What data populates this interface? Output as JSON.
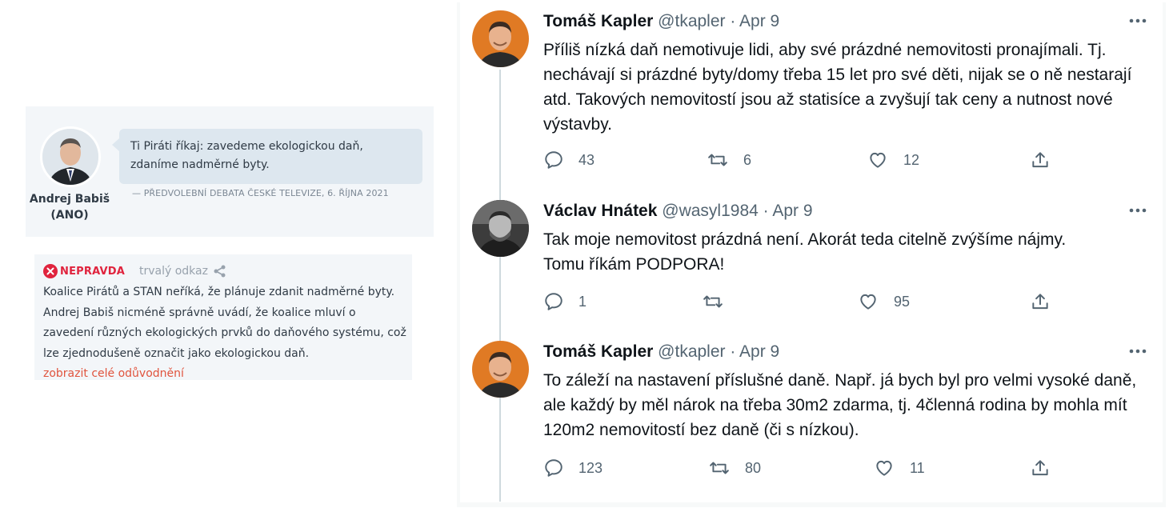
{
  "quote": {
    "text": "Ti Piráti říkaj: zavedeme ekologickou daň, zdaníme nadměrné byty.",
    "speaker": "Andrej Babiš (ANO)",
    "source": "— PŘEDVOLEBNÍ DEBATA ČESKÉ TELEVIZE, 6. ŘÍJNA 2021"
  },
  "verdict": {
    "label": "NEPRAVDA",
    "permalink": "trvalý odkaz",
    "text": "Koalice Pirátů a STAN neříká, že plánuje zdanit nadměrné byty. Andrej Babiš nicméně správně uvádí, že koalice mluví o zavedení různých ekologických prvků do daňového systému, což lze zjednodušeně označit jako ekologickou daň.",
    "link": "zobrazit celé odůvodnění",
    "color": "#e0233d"
  },
  "tweets": [
    {
      "name": "Tomáš Kapler",
      "handle": "@tkapler",
      "date": "Apr 9",
      "meta": "@tkapler · Apr 9",
      "text": "Příliš nízká daň nemotivuje lidi, aby své prázdné nemovitosti pronajímali. Tj. nechávají si prázdné byty/domy třeba 15 let pro své děti, nijak se o ně nestarají atd. Takových nemovitostí jsou až statisíce a zvyšují tak ceny a nutnost nové výstavby.",
      "replies": "43",
      "retweets": "6",
      "likes": "12"
    },
    {
      "name": "Václav Hnátek",
      "handle": "@wasyl1984",
      "date": "Apr 9",
      "meta": "@wasyl1984 · Apr 9",
      "text": "Tak moje nemovitost prázdná není. Akorát teda citelně zvýšíme nájmy. Tomu říkám PODPORA!",
      "replies": "1",
      "retweets": "",
      "likes": "95"
    },
    {
      "name": "Tomáš Kapler",
      "handle": "@tkapler",
      "date": "Apr 9",
      "meta": "@tkapler · Apr 9",
      "text": "To záleží na nastavení příslušné daně. Např. já bych byl pro velmi vysoké daně, ale každý by měl nárok na třeba 30m2 zdarma, tj. 4členná rodina by mohla mít 120m2 nemovitostí bez daně (či s nízkou).",
      "replies": "123",
      "retweets": "80",
      "likes": "11"
    }
  ],
  "icons": [
    "share-icon",
    "close-circle-icon",
    "more-icon",
    "reply-icon",
    "retweet-icon",
    "like-icon",
    "upload-icon"
  ]
}
